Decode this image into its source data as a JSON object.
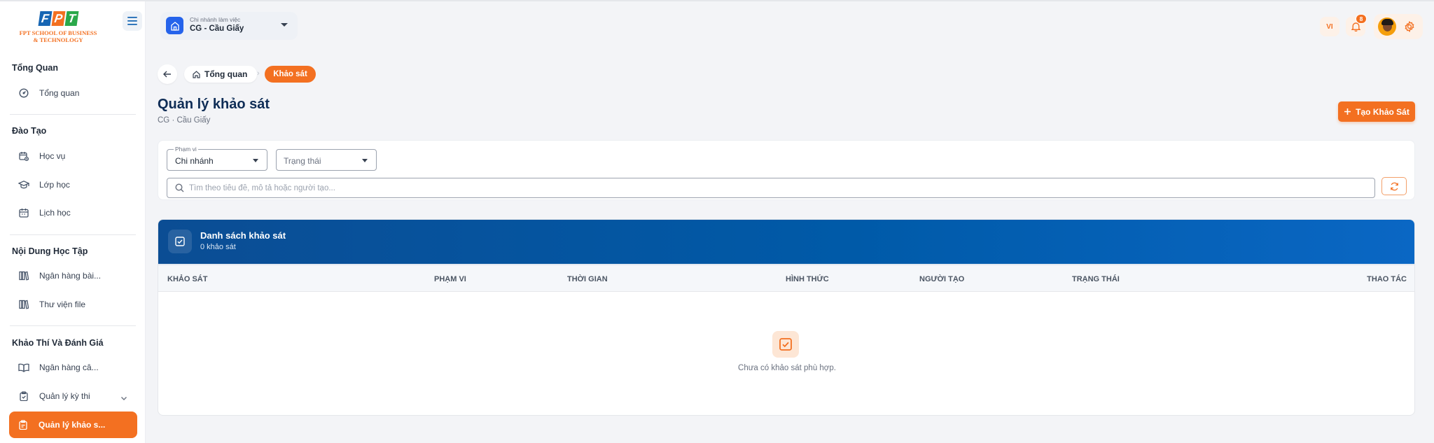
{
  "brand": {
    "letters": [
      "F",
      "P",
      "T"
    ],
    "line1": "FPT SCHOOL OF BUSINESS",
    "line2": "& TECHNOLOGY"
  },
  "sidebar": {
    "sections": [
      {
        "title": "Tổng Quan"
      },
      {
        "title": "Đào Tạo"
      },
      {
        "title": "Nội Dung Học Tập"
      },
      {
        "title": "Khảo Thí Và Đánh Giá"
      }
    ],
    "items": [
      {
        "label": "Tổng quan",
        "icon": "dashboard-icon"
      },
      {
        "label": "Học vụ",
        "icon": "academic-calendar-icon"
      },
      {
        "label": "Lớp học",
        "icon": "graduation-cap-icon"
      },
      {
        "label": "Lịch học",
        "icon": "calendar-icon"
      },
      {
        "label": "Ngân hàng bài...",
        "icon": "library-icon"
      },
      {
        "label": "Thư viện file",
        "icon": "library-icon"
      },
      {
        "label": "Ngân hàng câ...",
        "icon": "book-open-icon"
      },
      {
        "label": "Quản lý kỳ thi",
        "icon": "clipboard-check-icon"
      },
      {
        "label": "Quản lý khảo s...",
        "icon": "clipboard-list-icon",
        "active": true
      }
    ]
  },
  "header": {
    "branch_label": "Chi nhánh làm việc",
    "branch_value": "CG - Cầu Giấy",
    "language": "VI",
    "notification_count": "8"
  },
  "breadcrumb": {
    "home": "Tổng quan",
    "current": "Khảo sát"
  },
  "page": {
    "title": "Quản lý khảo sát",
    "subtitle": "CG · Cầu Giấy",
    "create_button": "Tạo Khảo Sát"
  },
  "filters": {
    "scope_label": "Phạm vi",
    "scope_value": "Chi nhánh",
    "status_placeholder": "Trạng thái",
    "search_placeholder": "Tìm theo tiêu đề, mô tả hoặc người tạo..."
  },
  "table": {
    "title": "Danh sách khảo sát",
    "count": "0 khảo sát",
    "columns": [
      "KHẢO SÁT",
      "PHẠM VI",
      "THỜI GIAN",
      "HÌNH THỨC",
      "NGƯỜI TẠO",
      "TRẠNG THÁI",
      "THAO TÁC"
    ],
    "empty_message": "Chưa có khảo sát phù hợp."
  },
  "colors": {
    "accent": "#f37021",
    "primary_blue": "#005aa8",
    "title_navy": "#0f2d56"
  }
}
